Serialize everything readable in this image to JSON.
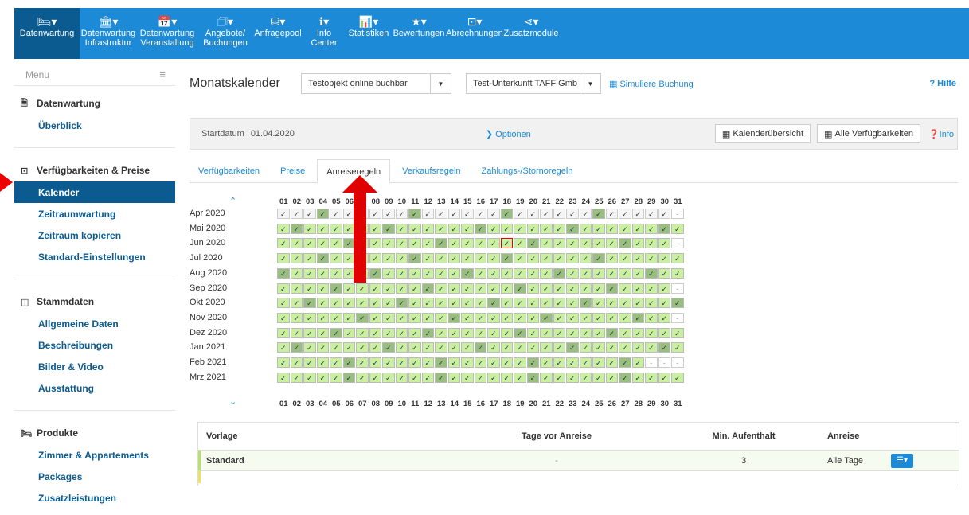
{
  "topnav": [
    {
      "icon": "bed-icon",
      "glyph": "🛏▾",
      "label": "Datenwartung",
      "active": true
    },
    {
      "icon": "building-icon",
      "glyph": "🏛▾",
      "label": "Datenwartung Infrastruktur"
    },
    {
      "icon": "calendar-icon",
      "glyph": "📅▾",
      "label": "Datenwartung Veranstaltung"
    },
    {
      "icon": "offer-icon",
      "glyph": "🗇▾",
      "label": "Angebote/ Buchungen"
    },
    {
      "icon": "pool-icon",
      "glyph": "⛁▾",
      "label": "Anfragepool"
    },
    {
      "icon": "info-icon",
      "glyph": "ℹ▾",
      "label": "Info Center"
    },
    {
      "icon": "statistics-icon",
      "glyph": "📊▾",
      "label": "Statistiken"
    },
    {
      "icon": "star-icon",
      "glyph": "★▾",
      "label": "Bewertungen"
    },
    {
      "icon": "billing-icon",
      "glyph": "⊡▾",
      "label": "Abrechnungen"
    },
    {
      "icon": "share-icon",
      "glyph": "⋖▾",
      "label": "Zusatzmodule"
    }
  ],
  "sidebar": {
    "menu_label": "Menu",
    "sections": [
      {
        "title": "Datenwartung",
        "icon": "document-icon",
        "glyph": "🗎",
        "items": [
          {
            "label": "Überblick"
          }
        ]
      },
      {
        "title": "Verfügbarkeiten & Preise",
        "icon": "money-icon",
        "glyph": "⊡",
        "items": [
          {
            "label": "Kalender",
            "active": true
          },
          {
            "label": "Zeitraumwartung"
          },
          {
            "label": "Zeitraum kopieren"
          },
          {
            "label": "Standard-Einstellungen"
          }
        ]
      },
      {
        "title": "Stammdaten",
        "icon": "columns-icon",
        "glyph": "◫",
        "items": [
          {
            "label": "Allgemeine Daten"
          },
          {
            "label": "Beschreibungen"
          },
          {
            "label": "Bilder & Video"
          },
          {
            "label": "Ausstattung"
          }
        ]
      },
      {
        "title": "Produkte",
        "icon": "bed-icon",
        "glyph": "🛏",
        "items": [
          {
            "label": "Zimmer & Appartements"
          },
          {
            "label": "Packages"
          },
          {
            "label": "Zusatzleistungen"
          }
        ]
      }
    ]
  },
  "header": {
    "title": "Monatskalender",
    "object_select": "Testobjekt online buchbar",
    "unit_select": "Test-Unterkunft TAFF Gmb",
    "simulate_link": "Simuliere Buchung",
    "help_link": "? Hilfe"
  },
  "info_bar": {
    "start_label": "Startdatum",
    "start_date": "01.04.2020",
    "options_link": "Optionen",
    "calendar_overview_btn": "Kalenderübersicht",
    "all_availability_btn": "Alle Verfügbarkeiten",
    "info_link": "Info"
  },
  "tabs": [
    {
      "label": "Verfügbarkeiten"
    },
    {
      "label": "Preise"
    },
    {
      "label": "Anreiseregeln",
      "active": true
    },
    {
      "label": "Verkaufsregeln"
    },
    {
      "label": "Zahlungs-/Stornoregeln"
    }
  ],
  "calendar": {
    "days": [
      "01",
      "02",
      "03",
      "04",
      "05",
      "06",
      "07",
      "08",
      "09",
      "10",
      "11",
      "12",
      "13",
      "14",
      "15",
      "16",
      "17",
      "18",
      "19",
      "20",
      "21",
      "22",
      "23",
      "24",
      "25",
      "26",
      "27",
      "28",
      "29",
      "30",
      "31"
    ],
    "months": [
      {
        "label": "Apr 2020",
        "days": 30,
        "dark": [
          4,
          11,
          18,
          25
        ]
      },
      {
        "label": "Mai 2020",
        "days": 31,
        "dark": [
          2,
          9,
          16,
          23,
          30
        ]
      },
      {
        "label": "Jun 2020",
        "days": 30,
        "dark": [
          6,
          13,
          20,
          27
        ],
        "selected": 18
      },
      {
        "label": "Jul 2020",
        "days": 31,
        "dark": [
          4,
          11,
          18,
          25
        ]
      },
      {
        "label": "Aug 2020",
        "days": 31,
        "dark": [
          1,
          8,
          15,
          22,
          29
        ]
      },
      {
        "label": "Sep 2020",
        "days": 30,
        "dark": [
          5,
          12,
          19,
          26
        ]
      },
      {
        "label": "Okt 2020",
        "days": 31,
        "dark": [
          3,
          10,
          17,
          24,
          31
        ]
      },
      {
        "label": "Nov 2020",
        "days": 30,
        "dark": [
          7,
          14,
          21,
          28
        ]
      },
      {
        "label": "Dez 2020",
        "days": 31,
        "dark": [
          5,
          12,
          19,
          26
        ]
      },
      {
        "label": "Jan 2021",
        "days": 31,
        "dark": [
          2,
          9,
          16,
          23,
          30
        ]
      },
      {
        "label": "Feb 2021",
        "days": 28,
        "dark": [
          6,
          13,
          20,
          27
        ]
      },
      {
        "label": "Mrz 2021",
        "days": 31,
        "dark": [
          6,
          13,
          20,
          27
        ]
      }
    ]
  },
  "rules_table": {
    "headers": [
      "Vorlage",
      "Tage vor Anreise",
      "Min. Aufenthalt",
      "Anreise"
    ],
    "rows": [
      {
        "template": "Standard",
        "days_before": "-",
        "min_stay": "3",
        "arrival": "Alle Tage"
      }
    ]
  },
  "colors": {
    "accent": "#1c8ad6",
    "nav_active": "#0b5b91",
    "green": "#c8f0a0",
    "green_dark": "#99bf80",
    "annotation": "#e00000"
  }
}
